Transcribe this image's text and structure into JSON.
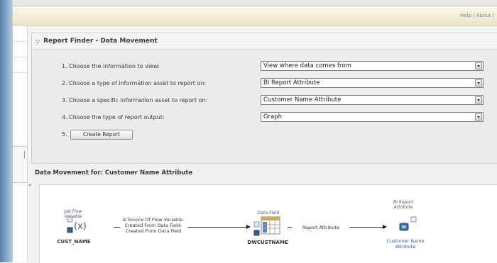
{
  "header": {
    "util_links": [
      "Help",
      "About"
    ]
  },
  "report_finder": {
    "title": "Report Finder - Data Movement",
    "rows": [
      {
        "label": "1. Choose the information to view:",
        "value": "View where data comes from"
      },
      {
        "label": "2. Choose a type of information asset to report on:",
        "value": "BI Report Attribute"
      },
      {
        "label": "3. Choose a specific information asset to report on:",
        "value": "Customer Name Attribute"
      },
      {
        "label": "4. Choose the type of report output:",
        "value": "Graph"
      }
    ],
    "step5_label": "5.",
    "create_button": "Create Report"
  },
  "data_movement": {
    "title": "Data Movement for: Customer Name Attribute",
    "nodes": [
      {
        "type_label": "Job Flow Variable",
        "name": "CUST_NAME",
        "icon": "job-flow-variable-icon"
      },
      {
        "type_label": "Data Field",
        "name": "DWCUSTNAME",
        "icon": "data-field-table-icon"
      },
      {
        "type_label": "BI Report Attribute",
        "name": "Customer Name Attribute",
        "icon": "bi-report-attribute-icon"
      }
    ],
    "edges": [
      {
        "label": "Is Source Of Flow Variable- Created From Data Field- Created From Data Field"
      },
      {
        "label": "Report Attribute"
      }
    ]
  },
  "colors": {
    "rail": "#5a7fa8",
    "util_bar": "#efe6c8",
    "link": "#2f63a8"
  }
}
